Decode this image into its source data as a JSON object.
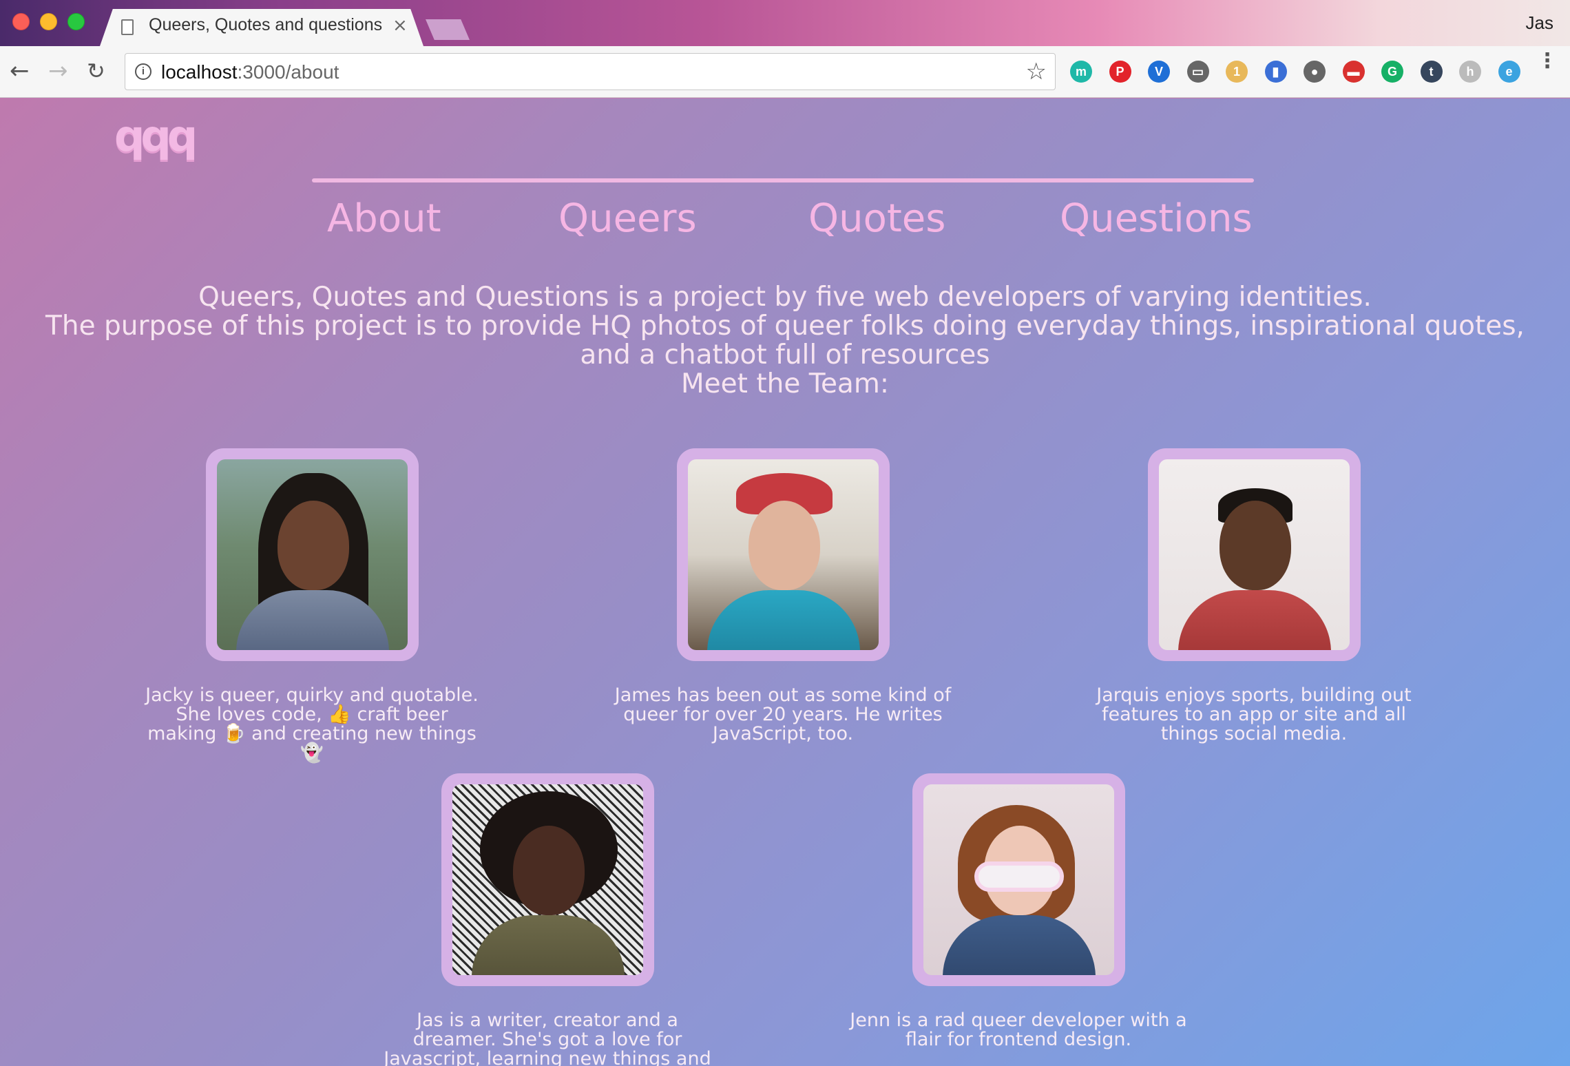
{
  "browser": {
    "tab_title": "Queers, Quotes and questions",
    "tab_close": "×",
    "profile_name": "Jas",
    "url_host": "localhost",
    "url_path": ":3000/about",
    "back_glyph": "←",
    "forward_glyph": "→",
    "reload_glyph": "↻",
    "bookmark_glyph": "☆",
    "menu_glyph": "⋮",
    "extensions": [
      {
        "name": "mercury-icon",
        "color": "#1fb8a8",
        "glyph": "m"
      },
      {
        "name": "pinterest-icon",
        "color": "#e2232b",
        "glyph": "P"
      },
      {
        "name": "vimeo-icon",
        "color": "#1f6fd6",
        "glyph": "V"
      },
      {
        "name": "cast-icon",
        "color": "#666666",
        "glyph": "▭"
      },
      {
        "name": "sticky-notes-icon",
        "color": "#e8b85a",
        "glyph": "1"
      },
      {
        "name": "bookmark-icon",
        "color": "#3b6fd6",
        "glyph": "▮"
      },
      {
        "name": "shield-icon",
        "color": "#666666",
        "glyph": "●"
      },
      {
        "name": "pocket-icon",
        "color": "#d9312f",
        "glyph": "▬"
      },
      {
        "name": "grammarly-icon",
        "color": "#16b066",
        "glyph": "G"
      },
      {
        "name": "tumblr-icon",
        "color": "#36465d",
        "glyph": "t"
      },
      {
        "name": "hkey-icon",
        "color": "#bbbbbb",
        "glyph": "h"
      },
      {
        "name": "feedly-icon",
        "color": "#3ba3e0",
        "glyph": "e"
      }
    ]
  },
  "site": {
    "logo": "qqq",
    "nav": [
      {
        "label": "About"
      },
      {
        "label": "Queers"
      },
      {
        "label": "Quotes"
      },
      {
        "label": "Questions"
      }
    ],
    "intro": [
      "Queers, Quotes and Questions is a project by five web developers of varying identities.",
      "The purpose of this project is to provide HQ photos of queer folks doing everyday things, inspirational quotes, and a chatbot full of resources",
      "Meet the Team:"
    ]
  },
  "team": [
    {
      "bio": "Jacky is queer, quirky and quotable. She loves code, 👍 craft beer making 🍺 and creating new things 👻"
    },
    {
      "bio": "James has been out as some kind of queer for over 20 years. He writes JavaScript, too."
    },
    {
      "bio": "Jarquis enjoys sports, building out features to an app or site and all things social media."
    },
    {
      "bio": "Jas is a writer, creator and a dreamer. She's got a love for Javascript, learning new things and #QueerBlackGirlMagic ."
    },
    {
      "bio": "Jenn is a rad queer developer with a flair for frontend design."
    }
  ]
}
